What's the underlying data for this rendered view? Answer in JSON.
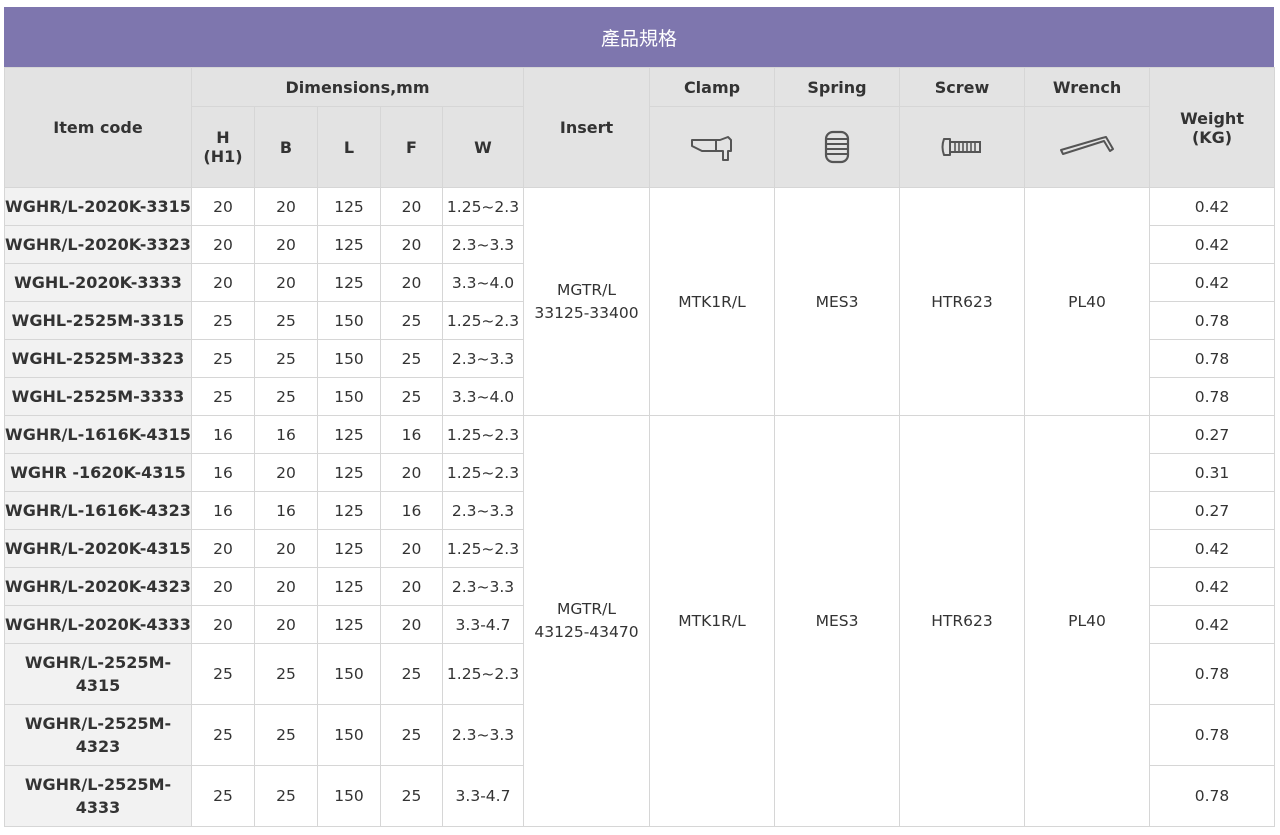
{
  "title": "產品規格",
  "headers": {
    "item_code": "Item code",
    "dimensions": "Dimensions,mm",
    "h": "H",
    "h1": "(H1)",
    "b": "B",
    "l": "L",
    "f": "F",
    "w": "W",
    "insert": "Insert",
    "clamp": "Clamp",
    "spring": "Spring",
    "screw": "Screw",
    "wrench": "Wrench",
    "weight": "Weight",
    "weight_unit": "(KG)"
  },
  "icons": {
    "clamp": "clamp-icon",
    "spring": "spring-icon",
    "screw": "screw-icon",
    "wrench": "wrench-icon"
  },
  "groups": [
    {
      "insert_line1": "MGTR/L",
      "insert_line2": "33125-33400",
      "clamp": "MTK1R/L",
      "spring": "MES3",
      "screw": "HTR623",
      "wrench": "PL40"
    },
    {
      "insert_line1": "MGTR/L",
      "insert_line2": "43125-43470",
      "clamp": "MTK1R/L",
      "spring": "MES3",
      "screw": "HTR623",
      "wrench": "PL40"
    }
  ],
  "rows": [
    {
      "code": "WGHR/L-2020K-3315",
      "h": "20",
      "b": "20",
      "l": "125",
      "f": "20",
      "w": "1.25~2.3",
      "weight": "0.42"
    },
    {
      "code": "WGHR/L-2020K-3323",
      "h": "20",
      "b": "20",
      "l": "125",
      "f": "20",
      "w": "2.3~3.3",
      "weight": "0.42"
    },
    {
      "code": "WGHL-2020K-3333",
      "h": "20",
      "b": "20",
      "l": "125",
      "f": "20",
      "w": "3.3~4.0",
      "weight": "0.42"
    },
    {
      "code": "WGHL-2525M-3315",
      "h": "25",
      "b": "25",
      "l": "150",
      "f": "25",
      "w": "1.25~2.3",
      "weight": "0.78"
    },
    {
      "code": "WGHL-2525M-3323",
      "h": "25",
      "b": "25",
      "l": "150",
      "f": "25",
      "w": "2.3~3.3",
      "weight": "0.78"
    },
    {
      "code": "WGHL-2525M-3333",
      "h": "25",
      "b": "25",
      "l": "150",
      "f": "25",
      "w": "3.3~4.0",
      "weight": "0.78"
    },
    {
      "code": "WGHR/L-1616K-4315",
      "h": "16",
      "b": "16",
      "l": "125",
      "f": "16",
      "w": "1.25~2.3",
      "weight": "0.27"
    },
    {
      "code": "WGHR -1620K-4315",
      "h": "16",
      "b": "20",
      "l": "125",
      "f": "20",
      "w": "1.25~2.3",
      "weight": "0.31"
    },
    {
      "code": "WGHR/L-1616K-4323",
      "h": "16",
      "b": "16",
      "l": "125",
      "f": "16",
      "w": "2.3~3.3",
      "weight": "0.27"
    },
    {
      "code": "WGHR/L-2020K-4315",
      "h": "20",
      "b": "20",
      "l": "125",
      "f": "20",
      "w": "1.25~2.3",
      "weight": "0.42"
    },
    {
      "code": "WGHR/L-2020K-4323",
      "h": "20",
      "b": "20",
      "l": "125",
      "f": "20",
      "w": "2.3~3.3",
      "weight": "0.42"
    },
    {
      "code": "WGHR/L-2020K-4333",
      "h": "20",
      "b": "20",
      "l": "125",
      "f": "20",
      "w": "3.3-4.7",
      "weight": "0.42"
    },
    {
      "code_line1": "WGHR/L-2525M-",
      "code_line2": "4315",
      "h": "25",
      "b": "25",
      "l": "150",
      "f": "25",
      "w": "1.25~2.3",
      "weight": "0.78"
    },
    {
      "code_line1": "WGHR/L-2525M-",
      "code_line2": "4323",
      "h": "25",
      "b": "25",
      "l": "150",
      "f": "25",
      "w": "2.3~3.3",
      "weight": "0.78"
    },
    {
      "code_line1": "WGHR/L-2525M-",
      "code_line2": "4333",
      "h": "25",
      "b": "25",
      "l": "150",
      "f": "25",
      "w": "3.3-4.7",
      "weight": "0.78"
    }
  ],
  "colors": {
    "title_bar": "#7e76ae",
    "header_bg": "#e3e3e3",
    "code_bg": "#f2f2f2",
    "border": "#d6d6d6"
  }
}
